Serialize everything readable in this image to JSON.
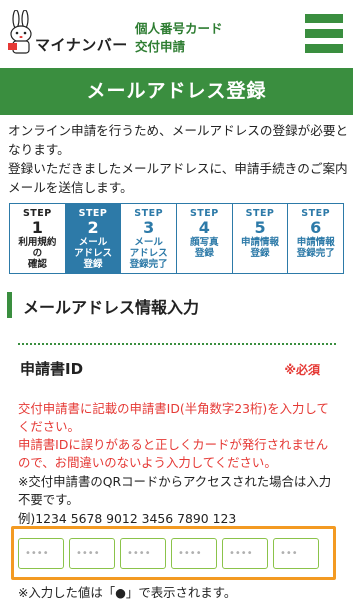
{
  "header": {
    "logo_text": "マイナンバー",
    "subtitle_line1": "個人番号カード",
    "subtitle_line2": "交付申請",
    "colors": {
      "brand_green": "#3a8e3f",
      "accent_blue": "#2d7aa8",
      "required_red": "#e53935",
      "focus_orange": "#f39a22"
    }
  },
  "page_title": "メールアドレス登録",
  "intro": {
    "line1": "オンライン申請を行うため、メールアドレスの登録が必要となります。",
    "line2": "登録いただきましたメールアドレスに、申請手続きのご案内メールを送信します。"
  },
  "steps": [
    {
      "label": "STEP",
      "num": "1",
      "name_lines": [
        "利用規約",
        "の",
        "確認"
      ]
    },
    {
      "label": "STEP",
      "num": "2",
      "name_lines": [
        "メール",
        "アドレス",
        "登録"
      ]
    },
    {
      "label": "STEP",
      "num": "3",
      "name_lines": [
        "メール",
        "アドレス",
        "登録完了"
      ]
    },
    {
      "label": "STEP",
      "num": "4",
      "name_lines": [
        "顔写真",
        "登録"
      ]
    },
    {
      "label": "STEP",
      "num": "5",
      "name_lines": [
        "申請情報",
        "登録"
      ]
    },
    {
      "label": "STEP",
      "num": "6",
      "name_lines": [
        "申請情報",
        "登録完了"
      ]
    }
  ],
  "section_title": "メールアドレス情報入力",
  "field": {
    "label": "申請書ID",
    "required": "※必須",
    "note_red_1": "交付申請書に記載の申請書ID(半角数字23桁)を入力してください。",
    "note_red_2": "申請書IDに誤りがあると正しくカードが発行されませんので、お間違いのないよう入力してください。",
    "note_black": "※交付申請書のQRコードからアクセスされた場合は入力不要です。",
    "example": "例)1234 5678 9012 3456 7890 123",
    "inputs": [
      {
        "placeholder": "••••",
        "value": ""
      },
      {
        "placeholder": "••••",
        "value": ""
      },
      {
        "placeholder": "••••",
        "value": ""
      },
      {
        "placeholder": "••••",
        "value": ""
      },
      {
        "placeholder": "••••",
        "value": ""
      },
      {
        "placeholder": "•••",
        "value": ""
      }
    ],
    "footnote": "※入力した値は「●」で表示されます。"
  }
}
